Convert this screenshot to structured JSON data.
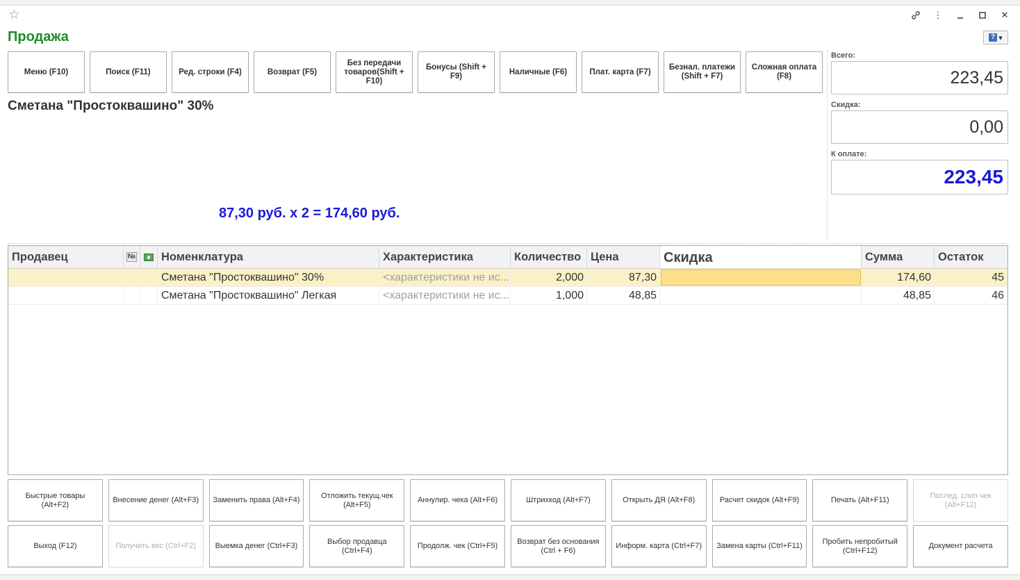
{
  "window": {
    "icons": [
      "star-icon",
      "link-icon",
      "more-icon",
      "minimize-icon",
      "maximize-icon",
      "close-icon"
    ]
  },
  "page": {
    "title": "Продажа",
    "help_label": "?"
  },
  "function_keys": [
    "Меню (F10)",
    "Поиск (F11)",
    "Ред. строки (F4)",
    "Возврат (F5)",
    "Без передачи товаров(Shift + F10)",
    "Бонусы (Shift + F9)",
    "Наличные (F6)",
    "Плат. карта (F7)",
    "Безнал. платежи (Shift + F7)",
    "Сложная оплата (F8)"
  ],
  "current_item": {
    "name": "Сметана \"Простоквашино\" 30%",
    "calc_line": "87,30 руб. x 2  = 174,60 руб."
  },
  "totals": {
    "total_label": "Всего:",
    "total_value": "223,45",
    "discount_label": "Скидка:",
    "discount_value": "0,00",
    "to_pay_label": "К оплате:",
    "to_pay_value": "223,45",
    "to_pay_color": "#1a1ad6"
  },
  "table": {
    "columns": {
      "seller": "Продавец",
      "no": "№",
      "item": "Номенклатура",
      "characteristic": "Характеристика",
      "qty": "Количество",
      "price": "Цена",
      "discount": "Скидка",
      "sum": "Сумма",
      "stock": "Остаток"
    },
    "rows": [
      {
        "seller": "",
        "item": "Сметана \"Простоквашино\" 30%",
        "characteristic": "<характеристики не ис...",
        "qty": "2,000",
        "price": "87,30",
        "discount": "",
        "sum": "174,60",
        "stock": "45"
      },
      {
        "seller": "",
        "item": "Сметана \"Простоквашино\" Легкая",
        "characteristic": "<характеристики не ис...",
        "qty": "1,000",
        "price": "48,85",
        "discount": "",
        "sum": "48,85",
        "stock": "46"
      }
    ]
  },
  "bottom_buttons_row1": [
    "Быстрые товары (Alt+F2)",
    "Внесение денег (Alt+F3)",
    "Заменить права (Alt+F4)",
    "Отложить текущ.чек (Alt+F5)",
    "Аннулир. чека (Alt+F6)",
    "Штрихкод (Alt+F7)",
    "Открыть ДЯ (Alt+F8)",
    "Расчет скидок (Alt+F9)",
    "Печать (Alt+F11)",
    "Послед. слип чек (Alt+F12)"
  ],
  "bottom_buttons_row2": [
    "Выход (F12)",
    "Получить вес (Ctrl+F2)",
    "Выемка денег (Ctrl+F3)",
    "Выбор продавца (Ctrl+F4)",
    "Продолж. чек (Ctrl+F5)",
    "Возврат без основания (Ctrl + F6)",
    "Информ. карта (Ctrl+F7)",
    "Замена карты (Ctrl+F11)",
    "Пробить непробитый (Ctrl+F12)",
    "Документ расчета"
  ]
}
